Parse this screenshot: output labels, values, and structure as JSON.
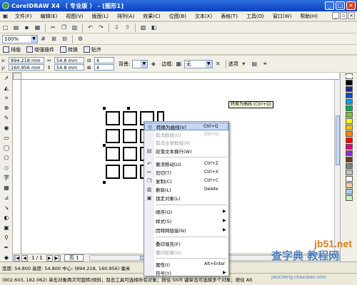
{
  "window": {
    "title": "CorelDRAW X4 （ 专业版 ） - [图形1]"
  },
  "menu": [
    "文件(F)",
    "编辑(E)",
    "视图(V)",
    "版面(L)",
    "排列(A)",
    "效果(C)",
    "位图(B)",
    "文本(X)",
    "表格(T)",
    "工具(O)",
    "窗口(W)",
    "帮助(H)"
  ],
  "toolbar": {
    "zoom": "100%"
  },
  "tabbar": [
    "排版",
    "增强插件",
    "转换",
    "贴齐"
  ],
  "props": {
    "x": "894.218 mm",
    "y": "160.956 mm",
    "w": "54.8 mm",
    "h": "54.8 mm",
    "cols": "4",
    "rows": "4",
    "bg_label": "背景:",
    "border_label": "边框:",
    "border_value": "无",
    "options_label": "选项"
  },
  "context_menu": {
    "items": [
      {
        "icon": "convert-curve-icon",
        "label": "转换为曲线(V)",
        "shortcut": "Ctrl+Q",
        "state": "highlight"
      },
      {
        "label": "取消群组(U)",
        "shortcut": "Ctrl+U",
        "state": "disabled"
      },
      {
        "label": "取消全部群组(N)",
        "shortcut": "",
        "state": "disabled"
      },
      {
        "icon": "text-icon",
        "label": "段落文本换行(W)",
        "shortcut": "",
        "state": "normal"
      },
      {
        "icon": "undo-icon",
        "label": "撤消移动(U)",
        "shortcut": "Ctrl+Z",
        "state": "normal"
      },
      {
        "icon": "cut-icon",
        "label": "剪切(T)",
        "shortcut": "Ctrl+X",
        "state": "normal"
      },
      {
        "icon": "copy-icon",
        "label": "复制(C)",
        "shortcut": "Ctrl+C",
        "state": "normal"
      },
      {
        "icon": "delete-icon",
        "label": "删除(L)",
        "shortcut": "Delete",
        "state": "normal"
      },
      {
        "icon": "lock-icon",
        "label": "锁定对象(L)",
        "shortcut": "",
        "state": "normal"
      },
      {
        "label": "顺序(O)",
        "shortcut": "",
        "submenu": true,
        "state": "normal"
      },
      {
        "label": "样式(S)",
        "shortcut": "",
        "submenu": true,
        "state": "normal"
      },
      {
        "label": "因特网链接(N)",
        "shortcut": "",
        "submenu": true,
        "state": "normal"
      },
      {
        "label": "叠印填充(F)",
        "shortcut": "",
        "state": "normal"
      },
      {
        "label": "叠印轮廓(O)",
        "shortcut": "",
        "state": "disabled"
      },
      {
        "label": "属性(I)",
        "shortcut": "Alt+Enter",
        "state": "normal"
      },
      {
        "label": "符号(Y)",
        "shortcut": "",
        "submenu": true,
        "state": "normal"
      }
    ],
    "tooltip": "转换为曲线 (Ctrl+Q)"
  },
  "pagebar": {
    "page_count": "1 / 1",
    "page_tab": "页 1"
  },
  "status": {
    "line1": "宽度: 54.800  高度: 54.800  中心: (894.218, 160.956)  毫米",
    "line2": "(902.603, 182.062)    单击对象两次可旋转/倾斜；双击工具可选择所有对象；按住 Shift 键单击可选择多个对象；按住 Alt"
  },
  "watermark": {
    "domain": "jb51.net",
    "cn": "查字典 教程网",
    "url": "jiaocheng.chazidian.com"
  },
  "colors": {
    "title_bar": "#0a3fc0",
    "menu_bg": "#f2f0e6",
    "highlight": "#c4d7f5"
  }
}
